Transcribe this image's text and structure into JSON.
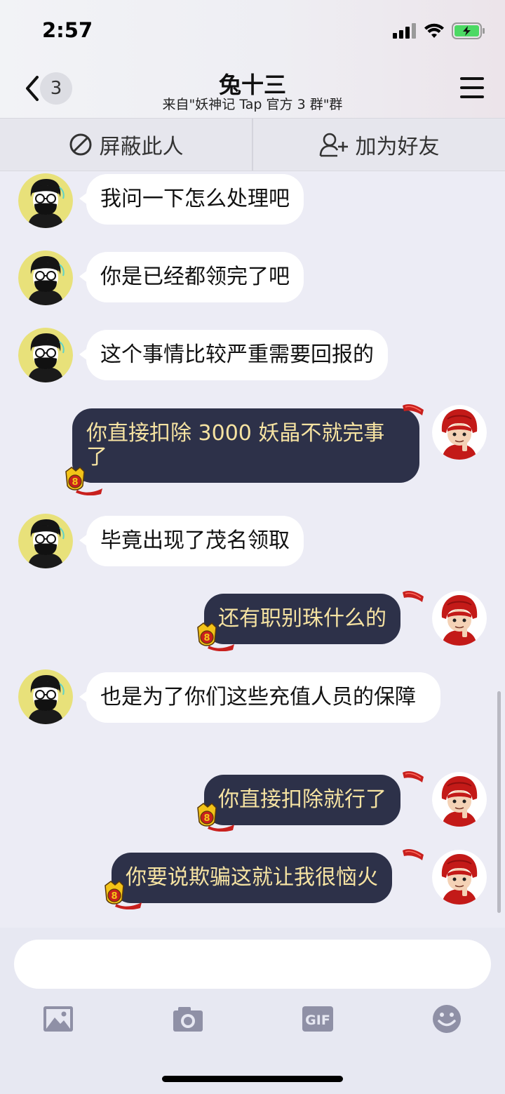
{
  "status_bar": {
    "time": "2:57"
  },
  "header": {
    "back_count": "3",
    "title": "兔十三",
    "subtitle": "来自\"妖神记 Tap 官方 3 群\"群"
  },
  "actions": {
    "block": "屏蔽此人",
    "add_friend": "加为好友"
  },
  "messages": [
    {
      "from": "other",
      "text": "我问一下怎么处理吧"
    },
    {
      "from": "other",
      "text": "你是已经都领完了吧"
    },
    {
      "from": "other",
      "text": "这个事情比较严重需要回报的"
    },
    {
      "from": "me",
      "text": "你直接扣除 3000 妖晶不就完事了"
    },
    {
      "from": "other",
      "text": "毕竟出现了茂名领取"
    },
    {
      "from": "me",
      "text": "还有职别珠什么的"
    },
    {
      "from": "other",
      "text": "也是为了你们这些充值人员的保障"
    },
    {
      "from": "me",
      "text": "你直接扣除就行了"
    },
    {
      "from": "me",
      "text": "你要说欺骗这就让我很恼火"
    }
  ],
  "badge_level": "8",
  "composer": {
    "placeholder": ""
  },
  "toolbar": {
    "gif_label": "GIF"
  },
  "icons": {
    "back": "chevron-left-icon",
    "menu": "hamburger-icon",
    "block": "block-icon",
    "add_friend": "add-user-icon",
    "image": "image-icon",
    "camera": "camera-icon",
    "gif": "gif-icon",
    "emoji": "emoji-icon"
  },
  "colors": {
    "outgoing_bubble": "#2d3149",
    "outgoing_text": "#f6e3a2",
    "incoming_bubble": "#ffffff",
    "background": "#ececf5"
  }
}
